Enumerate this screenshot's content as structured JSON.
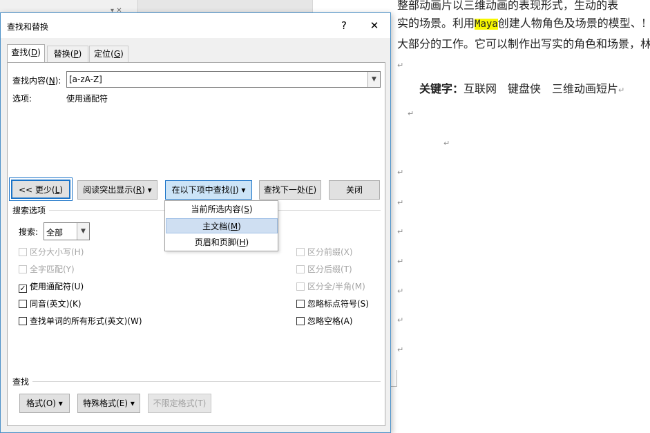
{
  "document": {
    "line1": "整部动画片以三维动画的表现形式，生动的表",
    "line2_before": "实的场景。利用",
    "line2_highlight": "Maya",
    "line2_after": "创建人物角色及场景的模型、!",
    "line3": "大部分的工作。它可以制作出写实的角色和场景，林",
    "keywords_label": "关键字：",
    "keywords_text": "互联网　键盘侠　三维动画短片",
    "para_mark": "↵"
  },
  "dialog": {
    "title": "查找和替换",
    "help_label": "?",
    "close_glyph": "✕",
    "tabs": [
      {
        "label": "查找(",
        "key": "D",
        "end": ")"
      },
      {
        "label": "替换(",
        "key": "P",
        "end": ")"
      },
      {
        "label": "定位(",
        "key": "G",
        "end": ")"
      }
    ],
    "find_label": "查找内容(",
    "find_label_key": "N",
    "find_label_end": "):",
    "find_value": "[a-zA-Z]",
    "options_label": "选项:",
    "options_value": "使用通配符",
    "buttons": {
      "less": "<< 更少(",
      "less_key": "L",
      "less_end": ")",
      "reading_highlight": "阅读突出显示(",
      "reading_highlight_key": "R",
      "reading_highlight_end": ") ▾",
      "find_in": "在以下项中查找(",
      "find_in_key": "I",
      "find_in_end": ") ▾",
      "find_next": "查找下一处(",
      "find_next_key": "F",
      "find_next_end": ")",
      "close": "关闭"
    },
    "find_in_menu": [
      {
        "label": "当前所选内容(",
        "key": "S",
        "end": ")"
      },
      {
        "label": "主文档(",
        "key": "M",
        "end": ")"
      },
      {
        "label": "页眉和页脚(",
        "key": "H",
        "end": ")"
      }
    ],
    "search_options_title": "搜索选项",
    "search_label": "搜索",
    "search_label_end": ":",
    "search_value": "全部",
    "left_options": [
      {
        "label": "区分大小写(H)",
        "checked": false,
        "disabled": true
      },
      {
        "label": "全字匹配(Y)",
        "checked": false,
        "disabled": true
      },
      {
        "label": "使用通配符(U)",
        "checked": true,
        "disabled": false
      },
      {
        "label": "同音(英文)(K)",
        "checked": false,
        "disabled": false
      },
      {
        "label": "查找单词的所有形式(英文)(W)",
        "checked": false,
        "disabled": false
      }
    ],
    "right_options": [
      {
        "label": "区分前缀(X)",
        "checked": false,
        "disabled": true
      },
      {
        "label": "区分后缀(T)",
        "checked": false,
        "disabled": true
      },
      {
        "label": "区分全/半角(M)",
        "checked": false,
        "disabled": true
      },
      {
        "label": "忽略标点符号(S)",
        "checked": false,
        "disabled": false
      },
      {
        "label": "忽略空格(A)",
        "checked": false,
        "disabled": false
      }
    ],
    "find_section_title": "查找",
    "bottom_buttons": {
      "format": "格式(O) ▾",
      "special": "特殊格式(E) ▾",
      "no_format": "不限定格式(T)"
    }
  },
  "colors": {
    "accent": "#1a73c8",
    "highlight": "#f7f700",
    "menu_hover": "#cfdff2"
  }
}
